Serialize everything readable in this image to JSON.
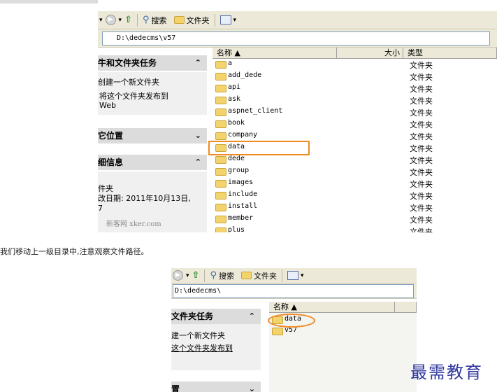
{
  "toolbar": {
    "back_arrow": "▾",
    "search": "搜索",
    "folders": "文件夹",
    "view_arrow": "▾"
  },
  "explorer1": {
    "address": "D:\\dedecms\\v57",
    "tasks_header": "牛和文件夹任务",
    "tasks": [
      "创建一个新文件夹",
      "将这个文件夹发布到",
      "Web"
    ],
    "places_header": "它位置",
    "details_header": "细信息",
    "details_lines": [
      "件夹",
      "改日期: 2011年10月13日,",
      "7"
    ],
    "chev_up": "⌃",
    "chev_down": "⌄",
    "columns": {
      "name": "名称 ▲",
      "size": "大小",
      "type": "类型"
    },
    "rows": [
      {
        "name": "a",
        "type": "文件夹"
      },
      {
        "name": "add_dede",
        "type": "文件夹"
      },
      {
        "name": "api",
        "type": "文件夹"
      },
      {
        "name": "ask",
        "type": "文件夹"
      },
      {
        "name": "aspnet_client",
        "type": "文件夹"
      },
      {
        "name": "book",
        "type": "文件夹"
      },
      {
        "name": "company",
        "type": "文件夹"
      },
      {
        "name": "data",
        "type": "文件夹"
      },
      {
        "name": "dede",
        "type": "文件夹"
      },
      {
        "name": "group",
        "type": "文件夹"
      },
      {
        "name": "images",
        "type": "文件夹"
      },
      {
        "name": "include",
        "type": "文件夹"
      },
      {
        "name": "install",
        "type": "文件夹"
      },
      {
        "name": "member",
        "type": "文件夹"
      },
      {
        "name": "plus",
        "type": "文件夹"
      }
    ],
    "watermark": "新客网 xker.com"
  },
  "caption": "我们移动上一级目录中,注意观察文件路径。",
  "explorer2": {
    "address": "D:\\dedecms\\",
    "tasks_header": "文件夹任务",
    "tasks": [
      "建一个新文件夹",
      "这个文件夹发布到"
    ],
    "other_header": "置",
    "columns": {
      "name": "名称 ▲"
    },
    "rows": [
      {
        "name": "data"
      },
      {
        "name": "v57"
      }
    ]
  },
  "watermark2": "最需教育",
  "colors": {
    "highlight": "#f08a24",
    "toolbar_bg": "#ece9d8",
    "folder": "#f3d36b"
  }
}
